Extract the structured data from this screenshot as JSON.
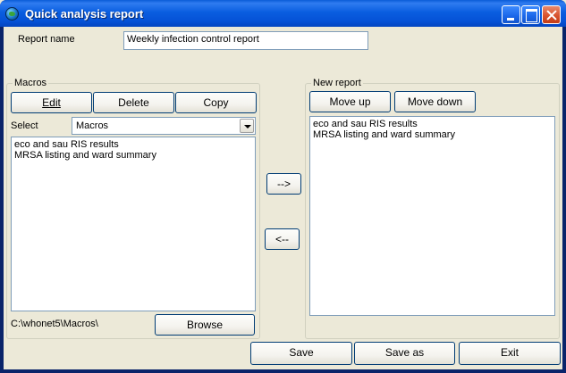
{
  "window": {
    "title": "Quick analysis report"
  },
  "report_name": {
    "label": "Report name",
    "value": "Weekly infection control report"
  },
  "macros": {
    "group_title": "Macros",
    "edit_button": "Edit",
    "delete_button": "Delete",
    "copy_button": "Copy",
    "select_label": "Select",
    "select_value": "Macros",
    "items": [
      "eco and sau RIS results",
      "MRSA listing and ward summary"
    ],
    "path": "C:\\whonet5\\Macros\\",
    "browse_button": "Browse"
  },
  "transfer": {
    "add_button": "-->",
    "remove_button": "<--"
  },
  "new_report": {
    "group_title": "New report",
    "move_up_button": "Move up",
    "move_down_button": "Move down",
    "items": [
      "eco and sau RIS results",
      "MRSA listing and ward summary"
    ]
  },
  "footer": {
    "save_button": "Save",
    "save_as_button": "Save as",
    "exit_button": "Exit"
  }
}
